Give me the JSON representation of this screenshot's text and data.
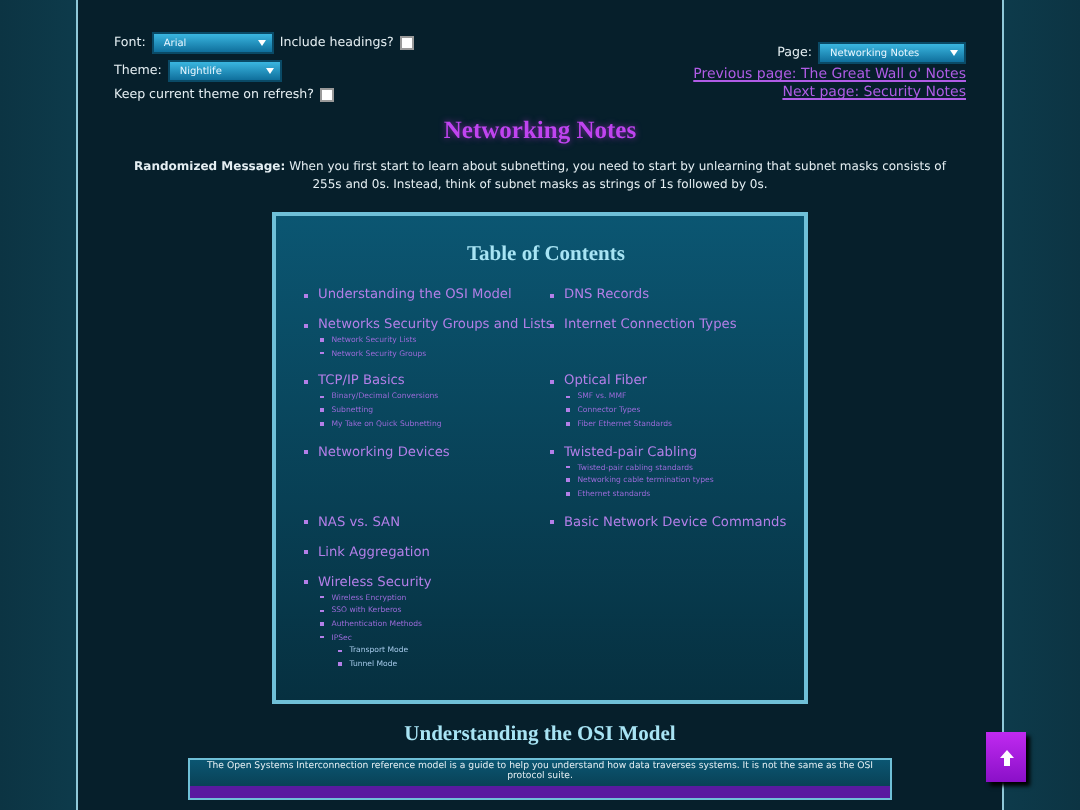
{
  "controls": {
    "font": {
      "label": "Font:",
      "value": "Arial"
    },
    "include_headings": {
      "label": "Include headings?",
      "checked": false
    },
    "theme": {
      "label": "Theme:",
      "value": "Nightlife"
    },
    "keep_theme": {
      "label": "Keep current theme on refresh?",
      "checked": false
    },
    "page": {
      "label": "Page:",
      "value": "Networking Notes"
    },
    "previous_link": "Previous page: The Great Wall o' Notes",
    "next_link": "Next page: Security Notes"
  },
  "title": "Networking Notes",
  "message": "**Randomized Message:** When you first start to learn about subnetting, you need to start by unlearning that subnet masks consists of 255s and 0s. Instead, think of subnet masks as strings of 1s followed by 0s.",
  "toc": {
    "title": "Table of Contents",
    "rows": [
      [
        {
          "label": "Understanding the OSI Model"
        },
        {
          "label": "DNS Records"
        }
      ],
      [
        {
          "label": "Networks Security Groups and Lists",
          "children": [
            {
              "label": "Network Security Lists"
            },
            {
              "label": "Network Security Groups"
            }
          ]
        },
        {
          "label": "Internet Connection Types"
        }
      ],
      [
        {
          "label": "TCP/IP Basics",
          "children": [
            {
              "label": "Binary/Decimal Conversions"
            },
            {
              "label": "Subnetting"
            },
            {
              "label": "My Take on Quick Subnetting"
            }
          ]
        },
        {
          "label": "Optical Fiber",
          "children": [
            {
              "label": "SMF vs. MMF"
            },
            {
              "label": "Connector Types"
            },
            {
              "label": "Fiber Ethernet Standards"
            }
          ]
        }
      ],
      [
        {
          "label": "Networking Devices"
        },
        {
          "label": "Twisted-pair Cabling",
          "children": [
            {
              "label": "Twisted-pair cabling standards"
            },
            {
              "label": "Networking cable termination types"
            },
            {
              "label": "Ethernet standards"
            }
          ]
        }
      ],
      [
        {
          "label": "NAS vs. SAN"
        },
        {
          "label": "Basic Network Device Commands"
        }
      ],
      [
        {
          "label": "Link Aggregation"
        }
      ],
      [
        {
          "label": "Wireless Security",
          "children": [
            {
              "label": "Wireless Encryption"
            },
            {
              "label": "SSO with Kerberos"
            },
            {
              "label": "Authentication Methods"
            },
            {
              "label": "IPSec",
              "children": [
                {
                  "label": "Transport Mode"
                },
                {
                  "label": "Tunnel Mode"
                }
              ]
            }
          ]
        }
      ]
    ]
  },
  "section": {
    "heading": "Understanding the OSI Model",
    "intro": "The Open Systems Interconnection reference model is a guide to help you understand how data traverses systems. It is not the same as the OSI protocol suite."
  }
}
